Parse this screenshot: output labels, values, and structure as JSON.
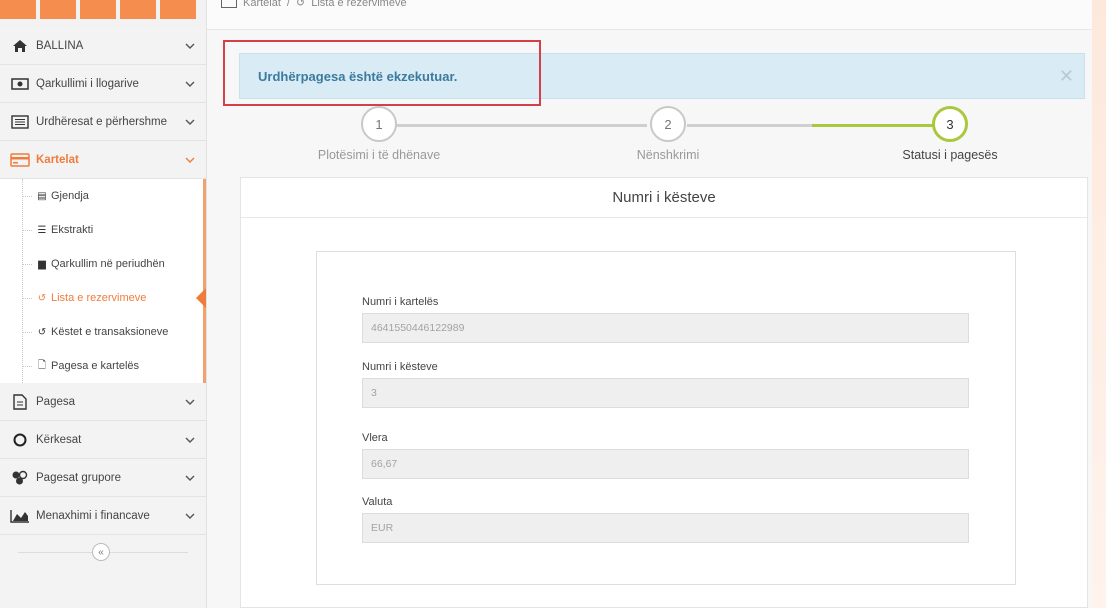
{
  "breadcrumb": {
    "items": [
      "Kartelat",
      "Lista e rezervimeve"
    ]
  },
  "sidebar": {
    "items": [
      {
        "label": "BALLINA",
        "icon": "home-icon"
      },
      {
        "label": "Qarkullimi i llogarive",
        "icon": "money-icon"
      },
      {
        "label": "Urdhëresat e përhershme",
        "icon": "list-box-icon"
      },
      {
        "label": "Kartelat",
        "icon": "credit-card-icon"
      }
    ],
    "submenu": [
      {
        "label": "Gjendja",
        "icon": "wallet-icon"
      },
      {
        "label": "Ekstrakti",
        "icon": "list-icon"
      },
      {
        "label": "Qarkullim në periudhën",
        "icon": "archive-icon"
      },
      {
        "label": "Lista e rezervimeve",
        "icon": "history-icon"
      },
      {
        "label": "Këstet e transaksioneve",
        "icon": "history-icon"
      },
      {
        "label": "Pagesa e kartelës",
        "icon": "file-icon"
      }
    ],
    "items_after": [
      {
        "label": "Pagesa",
        "icon": "document-icon"
      },
      {
        "label": "Kërkesat",
        "icon": "circle-icon"
      },
      {
        "label": "Pagesat grupore",
        "icon": "group-icon"
      },
      {
        "label": "Menaxhimi i financave",
        "icon": "area-chart-icon"
      }
    ],
    "collapse_label": "«"
  },
  "alert": {
    "message": "Urdhërpagesa është ekzekutuar.",
    "close": "✕"
  },
  "steps": [
    {
      "number": "1",
      "label": "Plotësimi i të dhënave",
      "state": "pending"
    },
    {
      "number": "2",
      "label": "Nënshkrimi",
      "state": "pending"
    },
    {
      "number": "3",
      "label": "Statusi i pagesës",
      "state": "done"
    }
  ],
  "panel": {
    "title": "Numri i kësteve",
    "fields": [
      {
        "label": "Numri i kartelës",
        "value": "4641550446122989"
      },
      {
        "label": "Numri i kësteve",
        "value": "3"
      },
      {
        "label": "Vlera",
        "value": "66,67"
      },
      {
        "label": "Valuta",
        "value": "EUR"
      }
    ]
  },
  "colors": {
    "accent": "#f07c3c",
    "step_done": "#a9c83d",
    "alert_bg": "#d9ecf5",
    "alert_text": "#3c7a9e",
    "highlight": "#d4404a"
  }
}
